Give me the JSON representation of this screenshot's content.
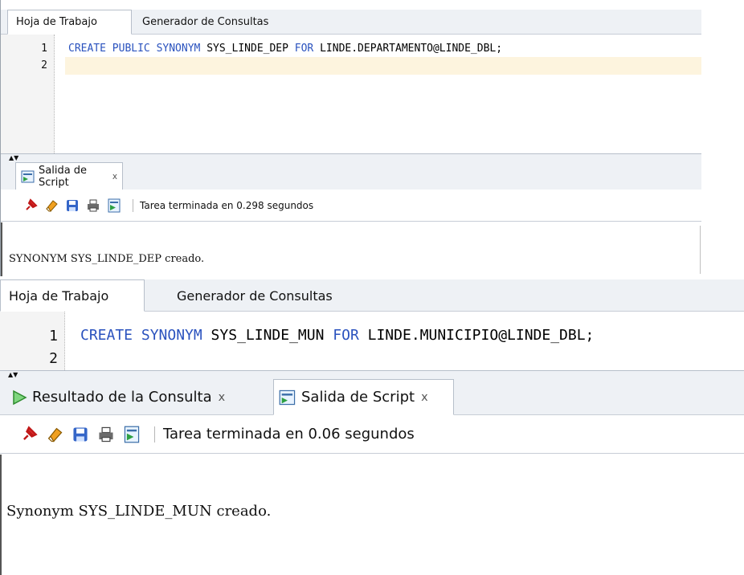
{
  "panel1": {
    "tabs": [
      "Hoja de Trabajo",
      "Generador de Consultas"
    ],
    "lines": [
      {
        "num": "1"
      },
      {
        "num": "2"
      }
    ],
    "code": {
      "kw1": "CREATE PUBLIC SYNONYM",
      "t1": " SYS_LINDE_DEP ",
      "kw2": "FOR",
      "t2": " LINDE.DEPARTAMENTO@LINDE_DBL;"
    },
    "output_tab": "Salida de Script",
    "close": "x",
    "status": "Tarea terminada en 0.298 segundos",
    "output": "SYNONYM SYS_LINDE_DEP creado."
  },
  "panel2": {
    "tabs": [
      "Hoja de Trabajo",
      "Generador de Consultas"
    ],
    "lines": [
      {
        "num": "1"
      },
      {
        "num": "2"
      }
    ],
    "code": {
      "kw1": "CREATE SYNONYM",
      "t1": " SYS_LINDE_MUN ",
      "kw2": "FOR",
      "t2": " LINDE.MUNICIPIO@LINDE_DBL;"
    },
    "output_tabs": [
      "Resultado de la Consulta",
      "Salida de Script"
    ],
    "close": "x",
    "status": "Tarea terminada en 0.06 segundos",
    "output": "Synonym SYS_LINDE_MUN creado."
  },
  "icons": [
    "pin-icon",
    "eraser-icon",
    "save-icon",
    "print-icon",
    "script-icon"
  ],
  "colors": {
    "keyword": "#2a52be",
    "current_line": "#fdf4de",
    "tab_bar": "#eef1f5"
  }
}
